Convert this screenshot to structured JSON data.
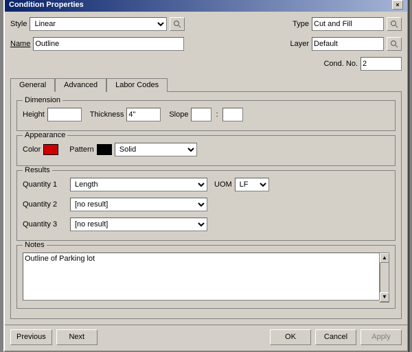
{
  "window": {
    "title": "Condition Properties",
    "close_btn": "×"
  },
  "header": {
    "style_label": "Style",
    "style_value": "Linear",
    "style_search_icon": "🔍",
    "type_label": "Type",
    "type_value": "Cut and Fill",
    "type_search_icon": "🔍",
    "name_label": "Name",
    "name_value": "Outline",
    "layer_label": "Layer",
    "layer_value": "Default",
    "layer_search_icon": "🔍",
    "condno_label": "Cond. No.",
    "condno_value": "2"
  },
  "tabs": [
    {
      "label": "General",
      "active": true
    },
    {
      "label": "Advanced",
      "active": false
    },
    {
      "label": "Labor Codes",
      "active": false
    }
  ],
  "dimension": {
    "group_label": "Dimension",
    "height_label": "Height",
    "height_value": "",
    "thickness_label": "Thickness",
    "thickness_value": "4\"",
    "slope_label": "Slope",
    "slope_value1": "",
    "slope_separator": ":",
    "slope_value2": ""
  },
  "appearance": {
    "group_label": "Appearance",
    "color_label": "Color",
    "color_hex": "#cc0000",
    "pattern_label": "Pattern",
    "pattern_color": "#000000",
    "pattern_value": "Solid"
  },
  "results": {
    "group_label": "Results",
    "qty1_label": "Quantity 1",
    "qty1_value": "Length",
    "uom_label": "UOM",
    "uom_value": "LF",
    "qty2_label": "Quantity 2",
    "qty2_value": "[no result]",
    "qty3_label": "Quantity 3",
    "qty3_value": "[no result]"
  },
  "notes": {
    "group_label": "Notes",
    "value": "Outline of Parking lot"
  },
  "buttons": {
    "previous": "Previous",
    "next": "Next",
    "ok": "OK",
    "cancel": "Cancel",
    "apply": "Apply"
  }
}
